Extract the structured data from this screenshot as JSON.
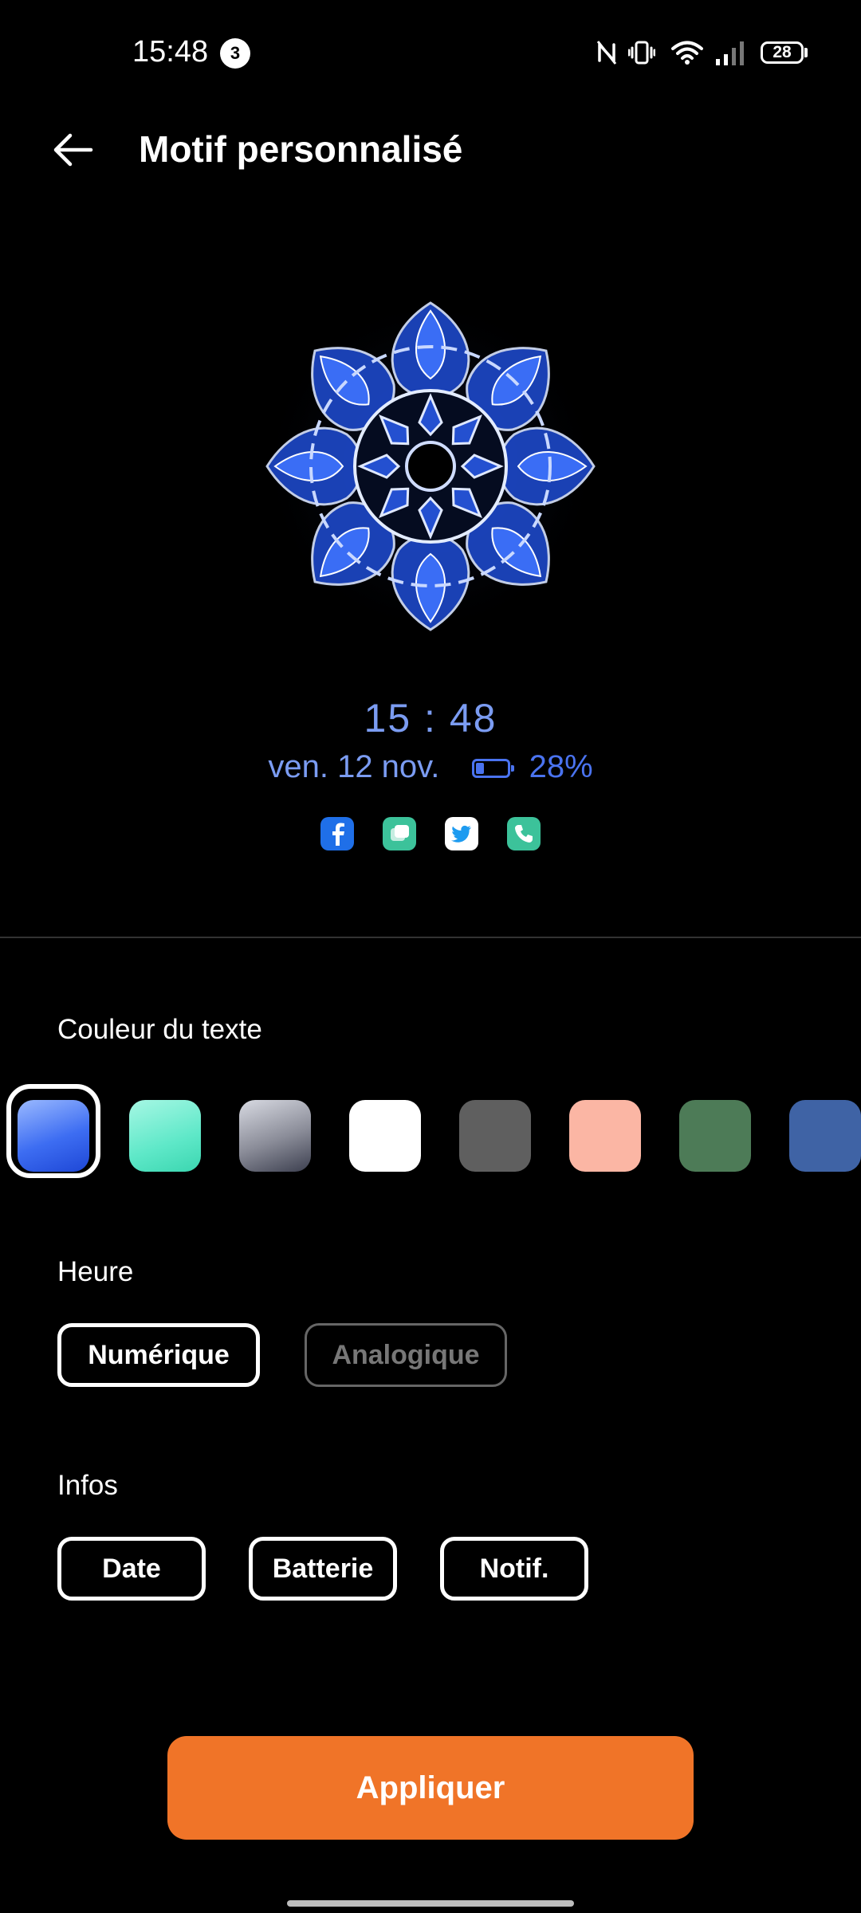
{
  "status_bar": {
    "time": "15:48",
    "notification_count": "3",
    "battery_level": "28",
    "icons": [
      "nfc-off-icon",
      "vibrate-icon",
      "wifi-icon",
      "signal-icon",
      "battery-icon"
    ]
  },
  "header": {
    "title": "Motif personnalisé",
    "back_icon": "arrow-left-icon"
  },
  "preview": {
    "time": "15 : 48",
    "date": "ven. 12 nov.",
    "battery_percent": "28%",
    "accent_color": "#7b9cf2",
    "app_icons": [
      "facebook-icon",
      "messages-icon",
      "twitter-icon",
      "phone-icon"
    ]
  },
  "text_color_section": {
    "label": "Couleur du texte",
    "swatches": [
      {
        "name": "blue-gradient",
        "color": "#3d6df2",
        "selected": true
      },
      {
        "name": "mint-gradient",
        "color": "#5ee8c8",
        "selected": false
      },
      {
        "name": "silver-gradient",
        "color": "#8a8c98",
        "selected": false
      },
      {
        "name": "white",
        "color": "#ffffff",
        "selected": false
      },
      {
        "name": "gray",
        "color": "#5f5f5f",
        "selected": false
      },
      {
        "name": "peach",
        "color": "#fbb6a4",
        "selected": false
      },
      {
        "name": "green",
        "color": "#4d7b57",
        "selected": false
      },
      {
        "name": "steel-blue",
        "color": "#3f63a5",
        "selected": false
      }
    ]
  },
  "time_section": {
    "label": "Heure",
    "options": [
      {
        "label": "Numérique",
        "selected": true
      },
      {
        "label": "Analogique",
        "selected": false
      }
    ]
  },
  "info_section": {
    "label": "Infos",
    "options": [
      {
        "label": "Date",
        "selected": true
      },
      {
        "label": "Batterie",
        "selected": true
      },
      {
        "label": "Notif.",
        "selected": true
      }
    ]
  },
  "apply_button": {
    "label": "Appliquer",
    "color": "#f07428"
  }
}
